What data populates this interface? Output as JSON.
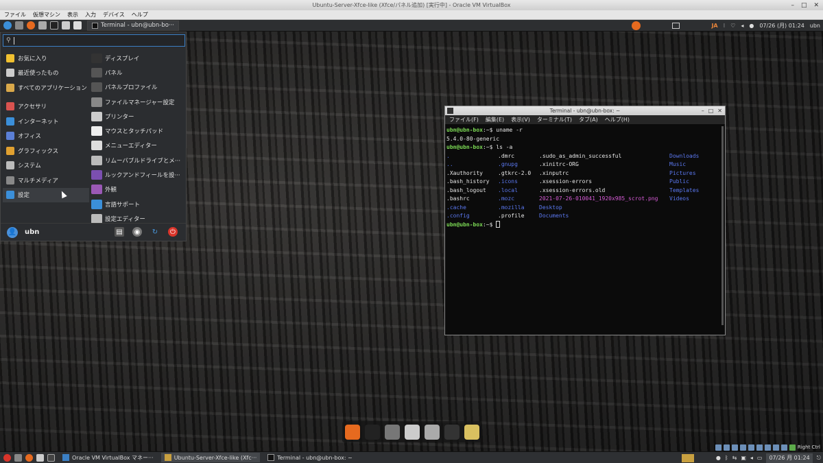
{
  "host_window": {
    "title": "Ubuntu-Server-Xfce-like (Xfce/パネル追加) [実行中] - Oracle VM VirtualBox",
    "menu": [
      "ファイル",
      "仮想マシン",
      "表示",
      "入力",
      "デバイス",
      "ヘルプ"
    ]
  },
  "top_panel": {
    "task_label": "Terminal - ubn@ubn-bo···",
    "ime": "JA",
    "clock": "07/26 (月) 01:24",
    "user_short": "ubn"
  },
  "menu": {
    "categories": [
      {
        "label": "お気に入り",
        "icon": "star-icon",
        "color": "#f0c030"
      },
      {
        "label": "最近使ったもの",
        "icon": "clock-icon",
        "color": "#cccccc"
      },
      {
        "label": "すべてのアプリケーション",
        "icon": "apps-icon",
        "color": "#d9a84a"
      },
      {
        "label": "アクセサリ",
        "icon": "accessories-icon",
        "color": "#d9534f"
      },
      {
        "label": "インターネット",
        "icon": "globe-icon",
        "color": "#3b8fd9"
      },
      {
        "label": "オフィス",
        "icon": "office-icon",
        "color": "#5b7fd6"
      },
      {
        "label": "グラフィックス",
        "icon": "graphics-icon",
        "color": "#e0a030"
      },
      {
        "label": "システム",
        "icon": "system-icon",
        "color": "#bbbbbb"
      },
      {
        "label": "マルチメディア",
        "icon": "multimedia-icon",
        "color": "#888888"
      },
      {
        "label": "設定",
        "icon": "settings-icon",
        "color": "#3b8fd9"
      }
    ],
    "apps": [
      {
        "label": "ディスプレイ",
        "icon": "display-icon",
        "color": "#333333"
      },
      {
        "label": "パネル",
        "icon": "panel-icon",
        "color": "#555555"
      },
      {
        "label": "パネルプロファイル",
        "icon": "panel-profile-icon",
        "color": "#555555"
      },
      {
        "label": "ファイルマネージャー設定",
        "icon": "file-manager-icon",
        "color": "#888888"
      },
      {
        "label": "プリンター",
        "icon": "printer-icon",
        "color": "#cccccc"
      },
      {
        "label": "マウスとタッチパッド",
        "icon": "mouse-icon",
        "color": "#eeeeee"
      },
      {
        "label": "メニューエディター",
        "icon": "menu-editor-icon",
        "color": "#dddddd"
      },
      {
        "label": "リムーバブルドライブとメ···",
        "icon": "removable-drive-icon",
        "color": "#bbbbbb"
      },
      {
        "label": "ルックアンドフィールを設···",
        "icon": "look-feel-icon",
        "color": "#7b4fb0"
      },
      {
        "label": "外観",
        "icon": "appearance-icon",
        "color": "#9b59b6"
      },
      {
        "label": "言語サポート",
        "icon": "language-icon",
        "color": "#3b8fd9"
      },
      {
        "label": "設定エディター",
        "icon": "settings-editor-icon",
        "color": "#bbbbbb"
      }
    ],
    "user": "ubn"
  },
  "terminal": {
    "title": "Terminal - ubn@ubn-box: ~",
    "menu": [
      "ファイル(F)",
      "編集(E)",
      "表示(V)",
      "ターミナル(T)",
      "タブ(A)",
      "ヘルプ(H)"
    ],
    "prompt": "ubn@ubn-box",
    "cmd1": ":~$ uname -r",
    "out1": "5.4.0-80-generic",
    "cmd2": ":~$ ls -a",
    "ls": [
      {
        "t": ".",
        "c": "blue"
      },
      {
        "t": ".dmrc",
        "c": ""
      },
      {
        "t": ".sudo_as_admin_successful",
        "c": ""
      },
      {
        "t": "Downloads",
        "c": "blue"
      },
      {
        "t": "..",
        "c": "blue"
      },
      {
        "t": ".gnupg",
        "c": "blue"
      },
      {
        "t": ".xinitrc-ORG",
        "c": ""
      },
      {
        "t": "Music",
        "c": "blue"
      },
      {
        "t": ".Xauthority",
        "c": ""
      },
      {
        "t": ".gtkrc-2.0",
        "c": ""
      },
      {
        "t": ".xinputrc",
        "c": ""
      },
      {
        "t": "Pictures",
        "c": "blue"
      },
      {
        "t": ".bash_history",
        "c": ""
      },
      {
        "t": ".icons",
        "c": "blue"
      },
      {
        "t": ".xsession-errors",
        "c": ""
      },
      {
        "t": "Public",
        "c": "blue"
      },
      {
        "t": ".bash_logout",
        "c": ""
      },
      {
        "t": ".local",
        "c": "blue"
      },
      {
        "t": ".xsession-errors.old",
        "c": ""
      },
      {
        "t": "Templates",
        "c": "blue"
      },
      {
        "t": ".bashrc",
        "c": ""
      },
      {
        "t": ".mozc",
        "c": "blue"
      },
      {
        "t": "2021-07-26-010041_1920x985_scrot.png",
        "c": "mag"
      },
      {
        "t": "Videos",
        "c": "blue"
      },
      {
        "t": ".cache",
        "c": "blue"
      },
      {
        "t": ".mozilla",
        "c": "blue"
      },
      {
        "t": "Desktop",
        "c": "blue"
      },
      {
        "t": "",
        "c": ""
      },
      {
        "t": ".config",
        "c": "blue"
      },
      {
        "t": ".profile",
        "c": ""
      },
      {
        "t": "Documents",
        "c": "blue"
      },
      {
        "t": "",
        "c": ""
      }
    ],
    "cmd3": ":~$"
  },
  "dock": [
    {
      "name": "firefox-icon",
      "color": "#e66a1f"
    },
    {
      "name": "terminal-icon",
      "color": "#222222"
    },
    {
      "name": "home-folder-icon",
      "color": "#777777"
    },
    {
      "name": "text-editor-icon",
      "color": "#cccccc"
    },
    {
      "name": "coffee-icon",
      "color": "#aaaaaa"
    },
    {
      "name": "media-player-icon",
      "color": "#333333"
    },
    {
      "name": "tools-icon",
      "color": "#d9c060"
    }
  ],
  "host_taskbar": {
    "tasks": [
      "Oracle VM VirtualBox マネー···",
      "Ubuntu-Server-Xfce-like (Xfc···",
      "Terminal - ubn@ubn-box: ~"
    ],
    "clock": "07/26 月 01:24",
    "right_ctrl": "Right Ctrl"
  }
}
